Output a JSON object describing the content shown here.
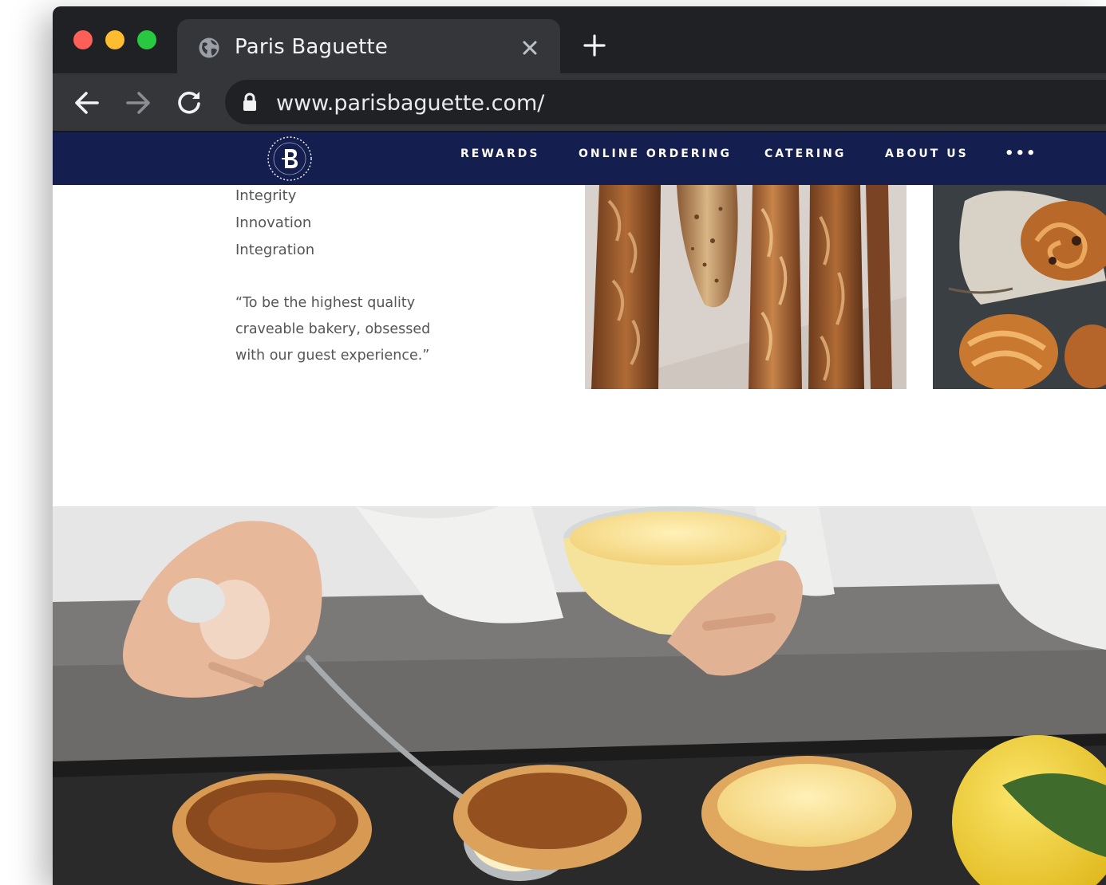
{
  "browser": {
    "tab_title": "Paris Baguette",
    "url": "www.parisbaguette.com/"
  },
  "site_nav": {
    "items": [
      {
        "label": "REWARDS"
      },
      {
        "label": "ONLINE ORDERING"
      },
      {
        "label": "CATERING"
      },
      {
        "label": "ABOUT US"
      }
    ],
    "more_label": "•••"
  },
  "values": [
    "Integrity",
    "Innovation",
    "Integration"
  ],
  "mission": [
    "“To be the highest quality",
    "craveable bakery, obsessed",
    "with our guest experience.”"
  ],
  "colors": {
    "nav_bg": "#141e4f",
    "chrome_dark": "#1f2124",
    "chrome_tab": "#35363a"
  }
}
